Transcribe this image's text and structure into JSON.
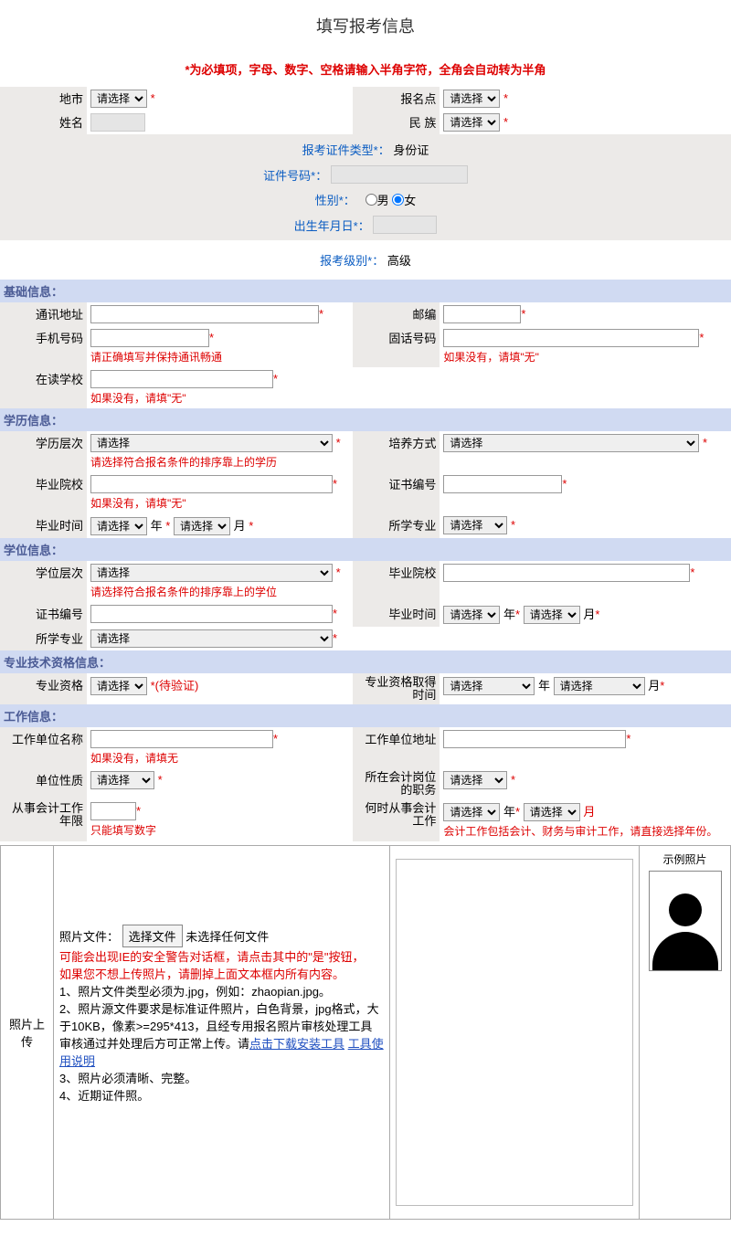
{
  "title": "填写报考信息",
  "required_note": "*为必填项，字母、数字、空格请输入半角字符，全角会自动转为半角",
  "placeholder_select": "请选择",
  "pending_verify": "*(待验证)",
  "labels": {
    "region": "地市",
    "exam_site": "报名点",
    "name": "姓名",
    "ethnicity": "民 族",
    "id_type": "报考证件类型*：",
    "id_type_value": "身份证",
    "id_number": "证件号码*：",
    "gender": "性别*：",
    "male": "男",
    "female": "女",
    "birthday": "出生年月日*：",
    "exam_level": "报考级别*：",
    "exam_level_value": "高级",
    "section_basic": "基础信息：",
    "address": "通讯地址",
    "postcode": "邮编",
    "mobile": "手机号码",
    "landline": "固话号码",
    "school": "在读学校",
    "section_edu": "学历信息：",
    "edu_level": "学历层次",
    "training_mode": "培养方式",
    "grad_school": "毕业院校",
    "cert_no": "证书编号",
    "grad_time": "毕业时间",
    "major": "所学专业",
    "section_degree": "学位信息：",
    "degree_level": "学位层次",
    "degree_school": "毕业院校",
    "degree_cert": "证书编号",
    "degree_time": "毕业时间",
    "degree_major": "所学专业",
    "section_qual": "专业技术资格信息：",
    "qual": "专业资格",
    "qual_time": "专业资格取得时间",
    "section_work": "工作信息：",
    "work_unit": "工作单位名称",
    "work_addr": "工作单位地址",
    "unit_nature": "单位性质",
    "position": "所在会计岗位的职务",
    "work_years": "从事会计工作年限",
    "engage_time": "何时从事会计工作",
    "year": "年",
    "month": "月",
    "photo_upload": "照片上传",
    "photo_file": "照片文件：",
    "sample_photo": "示例照片",
    "choose_file": "选择文件",
    "no_file": "未选择任何文件"
  },
  "hints": {
    "mobile": "请正确填写并保持通讯畅通",
    "landline": "如果没有，请填\"无\"",
    "school": "如果没有，请填\"无\"",
    "edu_level": "请选择符合报名条件的排序靠上的学历",
    "grad_school": "如果没有，请填\"无\"",
    "degree_level": "请选择符合报名条件的排序靠上的学位",
    "work_unit": "如果没有，请填无",
    "work_years": "只能填写数字",
    "engage_time": "会计工作包括会计、财务与审计工作，请直接选择年份。"
  },
  "upload_notes": {
    "warn1": "可能会出现IE的安全警告对话框，请点击其中的\"是\"按钮，",
    "warn2": "如果您不想上传照片，请删掉上面文本框内所有内容。",
    "rule1": "1、照片文件类型必须为.jpg，例如：zhaopian.jpg。",
    "rule2a": "2、照片源文件要求是标准证件照片，白色背景，jpg格式，大于10KB，像素>=295*413，且经专用报名照片审核处理工具审核通过并处理后方可正常上传。请",
    "link1": "点击下载安装工具",
    "link2": "工具使用说明",
    "rule3": "3、照片必须清晰、完整。",
    "rule4": "4、近期证件照。"
  }
}
